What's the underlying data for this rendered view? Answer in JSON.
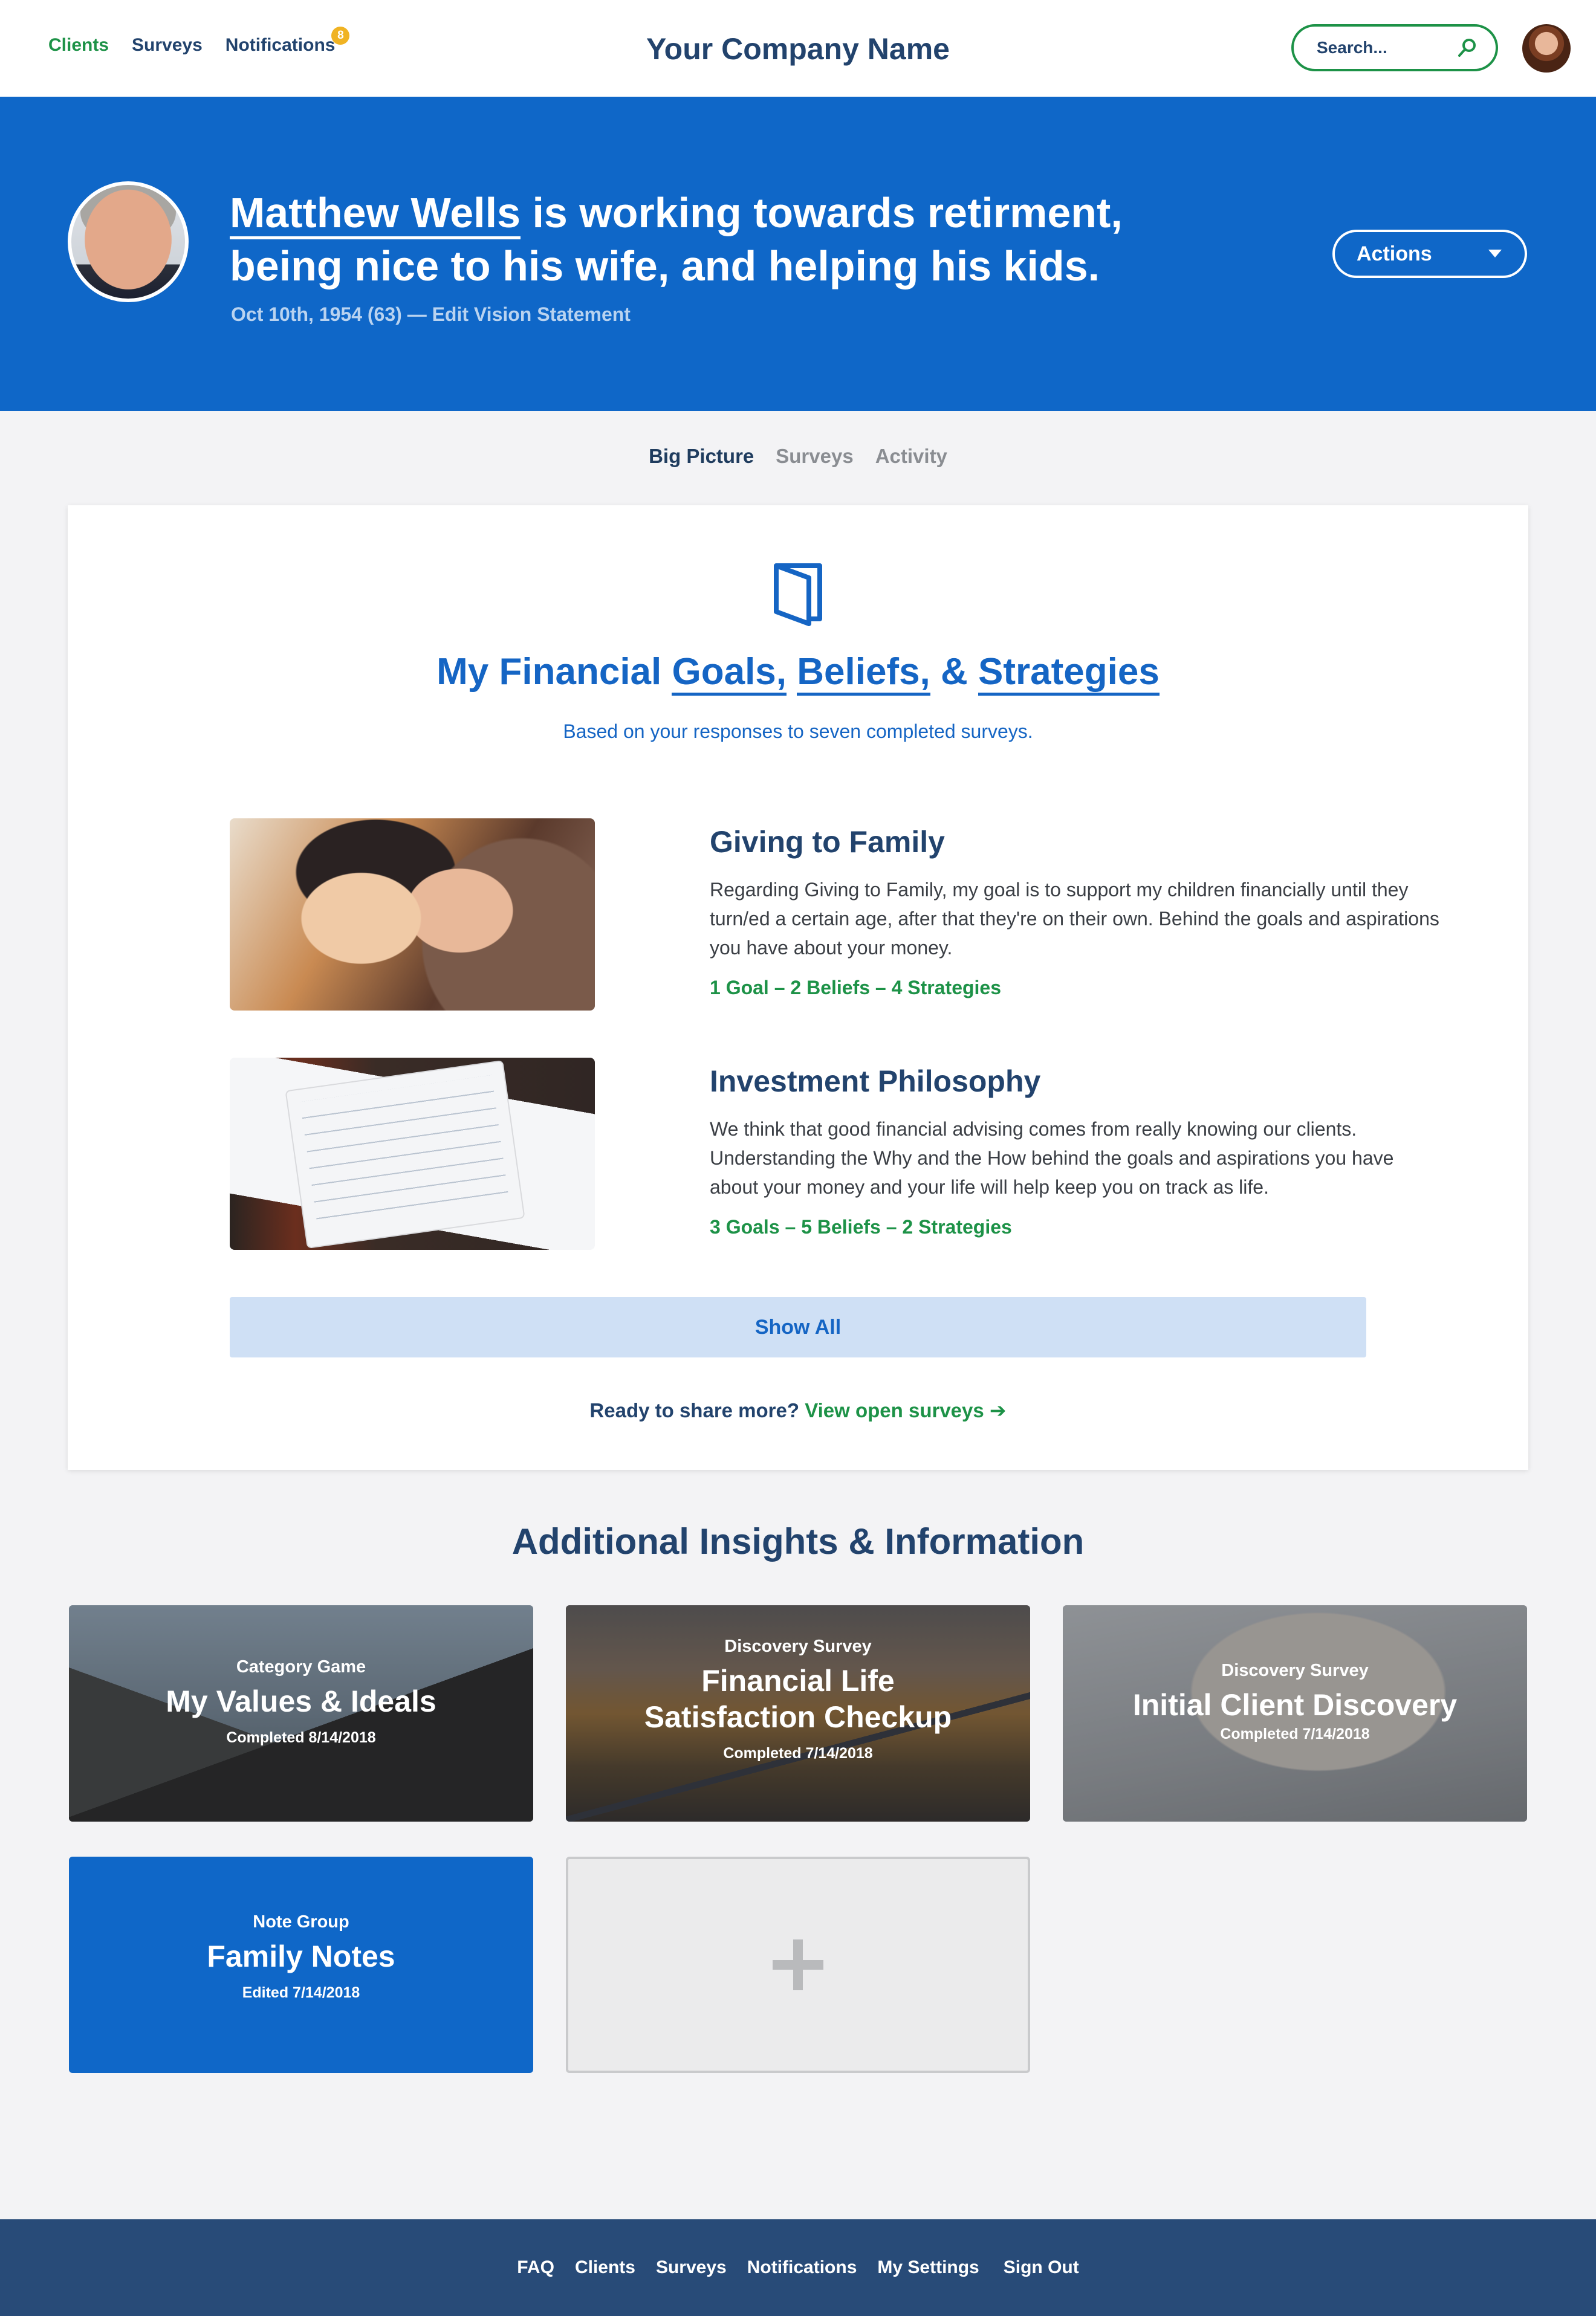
{
  "nav": {
    "links": [
      "Clients",
      "Surveys",
      "Notifications"
    ],
    "notification_count": "8",
    "brand": "Your Company Name",
    "search_placeholder": "Search...",
    "active_color": "#1d9247"
  },
  "hero": {
    "client_name": "Matthew Wells",
    "statement_line1_rest": " is working towards retirment,",
    "statement_line2": "being nice to his wife, and helping his kids.",
    "dob": "Oct 10th, 1954 (63)",
    "separator": " — ",
    "edit_link": "Edit Vision Statement",
    "actions_label": "Actions",
    "background_color": "#0f67c8"
  },
  "tabs": [
    "Big Picture",
    "Surveys",
    "Activity"
  ],
  "goals_card": {
    "icon": "book-icon",
    "title_prefix": "My Financial ",
    "title_goals": "Goals,",
    "title_beliefs": "Beliefs,",
    "title_amp": " & ",
    "title_strategies": "Strategies",
    "subtitle": "Based on your responses to seven completed surveys.",
    "items": [
      {
        "title": "Giving to Family",
        "description": "Regarding Giving to Family, my goal is to support my children financially until they turn/ed a certain age, after that they're on their own. Behind the goals and aspirations you have about your money.",
        "stats": "1 Goal – 2 Beliefs – 4 Strategies"
      },
      {
        "title": "Investment Philosophy",
        "description": "We think that good financial advising comes from really knowing our clients. Understanding the Why and the How behind the goals and aspirations you have about your money and your life will help keep you on track as life.",
        "stats": "3 Goals – 5 Beliefs – 2 Strategies"
      }
    ],
    "show_all_label": "Show All",
    "ready_text": "Ready to share more? ",
    "ready_link": "View open surveys ➔"
  },
  "insights": {
    "title": "Additional Insights & Information",
    "tiles": [
      {
        "kicker": "Category Game",
        "name": "My Values & Ideals",
        "date": "Completed 8/14/2018"
      },
      {
        "kicker": "Discovery Survey",
        "name_line1": "Financial Life",
        "name_line2": "Satisfaction Checkup",
        "date": "Completed 7/14/2018"
      },
      {
        "kicker": "Discovery Survey",
        "name": "Initial Client Discovery",
        "date": "Completed 7/14/2018"
      },
      {
        "kicker": "Note Group",
        "name": "Family Notes",
        "date": "Edited 7/14/2018"
      }
    ],
    "add_icon": "plus-icon"
  },
  "footer": {
    "links": [
      "FAQ",
      "Clients",
      "Surveys",
      "Notifications",
      "My Settings",
      "Sign Out"
    ],
    "background_color": "#284b78"
  }
}
